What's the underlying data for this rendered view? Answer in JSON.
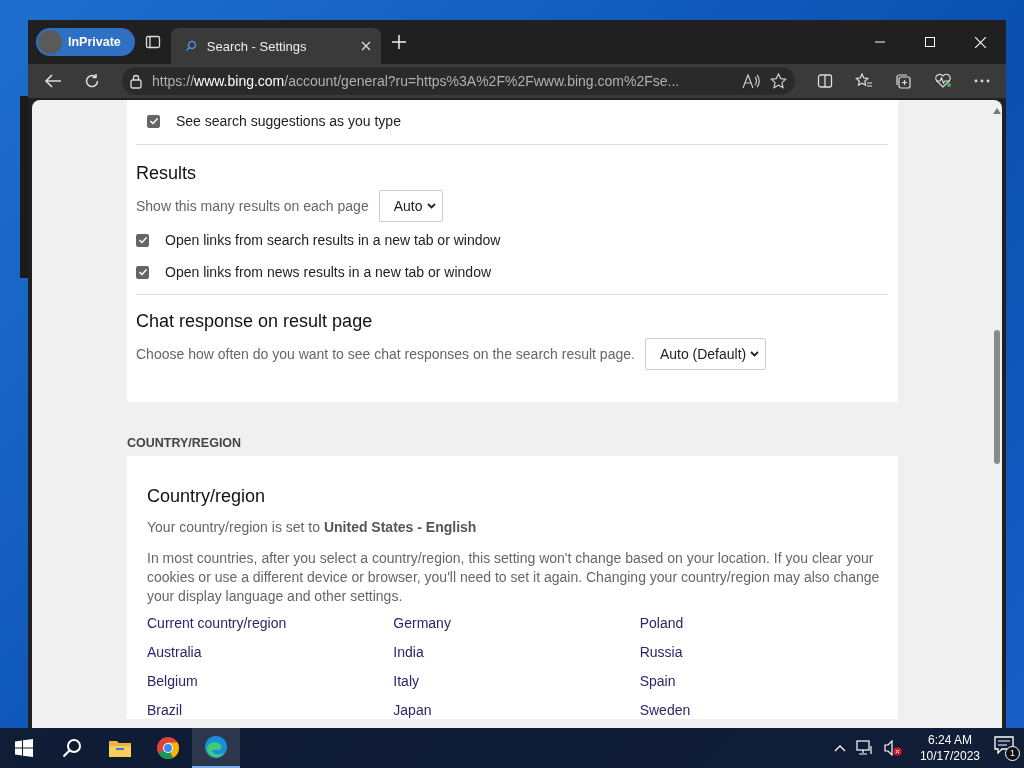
{
  "browser": {
    "profile": "InPrivate",
    "tabs": [
      {
        "title": "Search - Settings",
        "selected": true
      }
    ],
    "url": {
      "scheme": "https://",
      "host": "www.bing.com",
      "path": "/account/general?ru=https%3A%2F%2Fwww.bing.com%2Fse..."
    }
  },
  "suggestions": [
    {
      "label": "See search suggestions as you type",
      "checked": true
    }
  ],
  "results": {
    "title": "Results",
    "per_page_label": "Show this many results on each page",
    "per_page_value": "Auto",
    "options": [
      {
        "label": "Open links from search results in a new tab or window",
        "checked": true
      },
      {
        "label": "Open links from news results in a new tab or window",
        "checked": true
      }
    ]
  },
  "chat": {
    "title": "Chat response on result page",
    "description": "Choose how often do you want to see chat responses on the search result page.",
    "value": "Auto (Default)"
  },
  "country_heading": "COUNTRY/REGION",
  "country": {
    "title": "Country/region",
    "current": "Your country/region is set to **United States - English**",
    "note": "In most countries, after you select a country/region, this setting won't change based on your location. If you clear your cookies or use a different device or browser, you'll need to set it again. Changing your country/region may also change your display language and other settings.",
    "link_columns": [
      [
        "Current country/region",
        "Australia",
        "Belgium",
        "Brazil"
      ],
      [
        "Germany",
        "India",
        "Italy",
        "Japan"
      ],
      [
        "Poland",
        "Russia",
        "Spain",
        "Sweden"
      ]
    ]
  },
  "taskbar": {
    "time": "6:24 AM",
    "date": "10/17/2023",
    "notifications": "1"
  }
}
